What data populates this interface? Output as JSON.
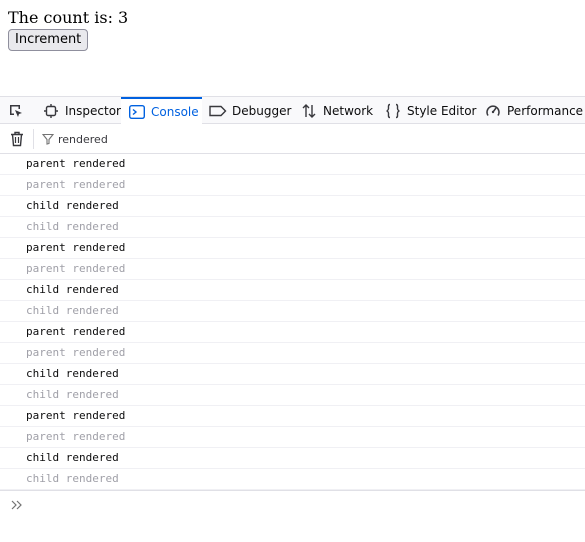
{
  "page": {
    "count_label": "The count is: 3",
    "increment_label": "Increment"
  },
  "devtools": {
    "tabs": [
      {
        "label": "Inspector",
        "icon": "inspector-icon",
        "active": false
      },
      {
        "label": "Console",
        "icon": "console-icon",
        "active": true
      },
      {
        "label": "Debugger",
        "icon": "debugger-icon",
        "active": false
      },
      {
        "label": "Network",
        "icon": "network-icon",
        "active": false
      },
      {
        "label": "Style Editor",
        "icon": "style-editor-icon",
        "active": false
      },
      {
        "label": "Performance",
        "icon": "performance-icon",
        "active": false
      }
    ],
    "filter": {
      "value": "rendered"
    },
    "log": [
      {
        "text": "parent rendered",
        "dim": false
      },
      {
        "text": "parent rendered",
        "dim": true
      },
      {
        "text": "child rendered",
        "dim": false
      },
      {
        "text": "child rendered",
        "dim": true
      },
      {
        "text": "parent rendered",
        "dim": false
      },
      {
        "text": "parent rendered",
        "dim": true
      },
      {
        "text": "child rendered",
        "dim": false
      },
      {
        "text": "child rendered",
        "dim": true
      },
      {
        "text": "parent rendered",
        "dim": false
      },
      {
        "text": "parent rendered",
        "dim": true
      },
      {
        "text": "child rendered",
        "dim": false
      },
      {
        "text": "child rendered",
        "dim": true
      },
      {
        "text": "parent rendered",
        "dim": false
      },
      {
        "text": "parent rendered",
        "dim": true
      },
      {
        "text": "child rendered",
        "dim": false
      },
      {
        "text": "child rendered",
        "dim": true
      }
    ]
  },
  "colors": {
    "accent": "#0061e0",
    "dim_text": "#a0a0a8",
    "toolbar_bg": "#f9f9fb"
  }
}
